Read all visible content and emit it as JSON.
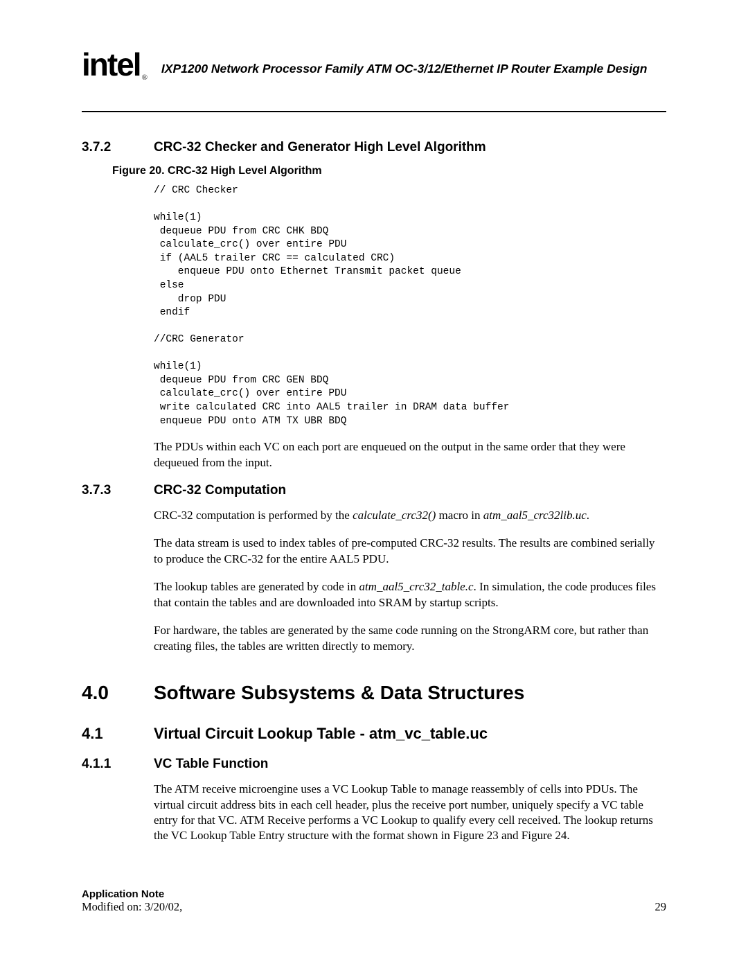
{
  "header": {
    "logo": "intel",
    "reg": "®",
    "doc_title": "IXP1200 Network Processor Family ATM OC-3/12/Ethernet IP Router Example Design"
  },
  "s372": {
    "num": "3.7.2",
    "title": "CRC-32 Checker and Generator High Level Algorithm",
    "fig_caption": "Figure 20. CRC-32 High Level Algorithm",
    "code": "// CRC Checker\n\nwhile(1)\n dequeue PDU from CRC CHK BDQ\n calculate_crc() over entire PDU\n if (AAL5 trailer CRC == calculated CRC)\n    enqueue PDU onto Ethernet Transmit packet queue\n else\n    drop PDU\n endif\n\n//CRC Generator\n\nwhile(1)\n dequeue PDU from CRC GEN BDQ\n calculate_crc() over entire PDU\n write calculated CRC into AAL5 trailer in DRAM data buffer\n enqueue PDU onto ATM TX UBR BDQ",
    "after_code": "The PDUs within each VC on each port are enqueued on the output in the same order that they were dequeued from the input."
  },
  "s373": {
    "num": "3.7.3",
    "title": "CRC-32 Computation",
    "p1_a": "CRC-32 computation is performed by the ",
    "p1_i1": "calculate_crc32()",
    "p1_b": " macro in ",
    "p1_i2": "atm_aal5_crc32lib.uc",
    "p1_c": ".",
    "p2": "The data stream is used to index tables of pre-computed CRC-32 results. The results are combined serially to produce the CRC-32 for the entire AAL5 PDU.",
    "p3_a": "The lookup tables are generated by code in ",
    "p3_i": "atm_aal5_crc32_table.c",
    "p3_b": ". In simulation, the code produces files that contain the tables and are downloaded into SRAM by startup scripts.",
    "p4": "For hardware, the tables are generated by the same code running on the StrongARM core, but rather than creating files, the tables are written directly to memory."
  },
  "s40": {
    "num": "4.0",
    "title": "Software Subsystems & Data Structures"
  },
  "s41": {
    "num": "4.1",
    "title": "Virtual Circuit Lookup Table - atm_vc_table.uc"
  },
  "s411": {
    "num": "4.1.1",
    "title": "VC Table Function",
    "p1": "The ATM receive microengine uses a VC Lookup Table to manage reassembly of cells into PDUs. The virtual circuit address bits in each cell header, plus the receive port number, uniquely specify a VC table entry for that VC. ATM Receive performs a VC Lookup to qualify every cell received. The lookup returns the VC Lookup Table Entry structure with the format shown in Figure 23 and Figure 24."
  },
  "footer": {
    "appnote": "Application Note",
    "modified": "Modified on: 3/20/02,",
    "page": "29"
  }
}
